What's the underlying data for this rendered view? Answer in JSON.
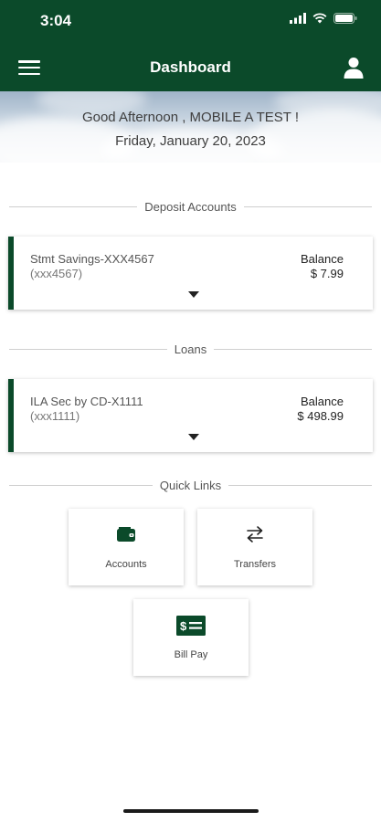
{
  "status_bar": {
    "time": "3:04"
  },
  "header": {
    "title": "Dashboard",
    "menu_icon": "hamburger-menu-icon",
    "profile_icon": "user-icon"
  },
  "greeting": {
    "message": "Good Afternoon , MOBILE A TEST !",
    "date": "Friday, January 20, 2023"
  },
  "deposit_section": {
    "title": "Deposit Accounts",
    "accounts": [
      {
        "name": "Stmt Savings-XXX4567",
        "number": "(xxx4567)",
        "balance_label": "Balance",
        "balance": "$ 7.99"
      }
    ]
  },
  "loans_section": {
    "title": "Loans",
    "accounts": [
      {
        "name": "ILA Sec by CD-X1111",
        "number": "(xxx1111)",
        "balance_label": "Balance",
        "balance": "$ 498.99"
      }
    ]
  },
  "quick_links": {
    "title": "Quick Links",
    "items": [
      {
        "label": "Accounts",
        "icon": "wallet-icon"
      },
      {
        "label": "Transfers",
        "icon": "transfer-arrows-icon"
      },
      {
        "label": "Bill Pay",
        "icon": "bill-pay-icon"
      }
    ]
  },
  "colors": {
    "brand_green": "#0b4a2a",
    "background": "#ffffff"
  }
}
